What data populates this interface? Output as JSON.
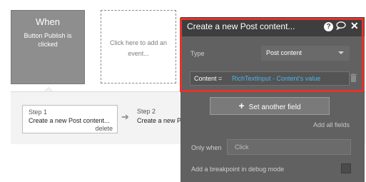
{
  "events": {
    "card": {
      "title": "When",
      "subtitle": "Button Publish is clicked"
    },
    "add_event": "Click here to add an event..."
  },
  "steps": {
    "step1": {
      "number": "Step 1",
      "name": "Create a new Post content...",
      "delete_label": "delete"
    },
    "step2": {
      "number": "Step 2",
      "name": "Create a new P"
    }
  },
  "editor": {
    "title": "Create a new Post content...",
    "type_label": "Type",
    "type_value": "Post content",
    "field_name": "Content =",
    "field_value": "RichTextInput - Content's value",
    "set_another_field": "Set another field",
    "add_all_fields": "Add all fields",
    "only_when_label": "Only when",
    "only_when_placeholder": "Click",
    "breakpoint_label": "Add a breakpoint in debug mode"
  },
  "colors": {
    "highlight": "#e4332b",
    "dynamic_value": "#4fb3e8"
  }
}
